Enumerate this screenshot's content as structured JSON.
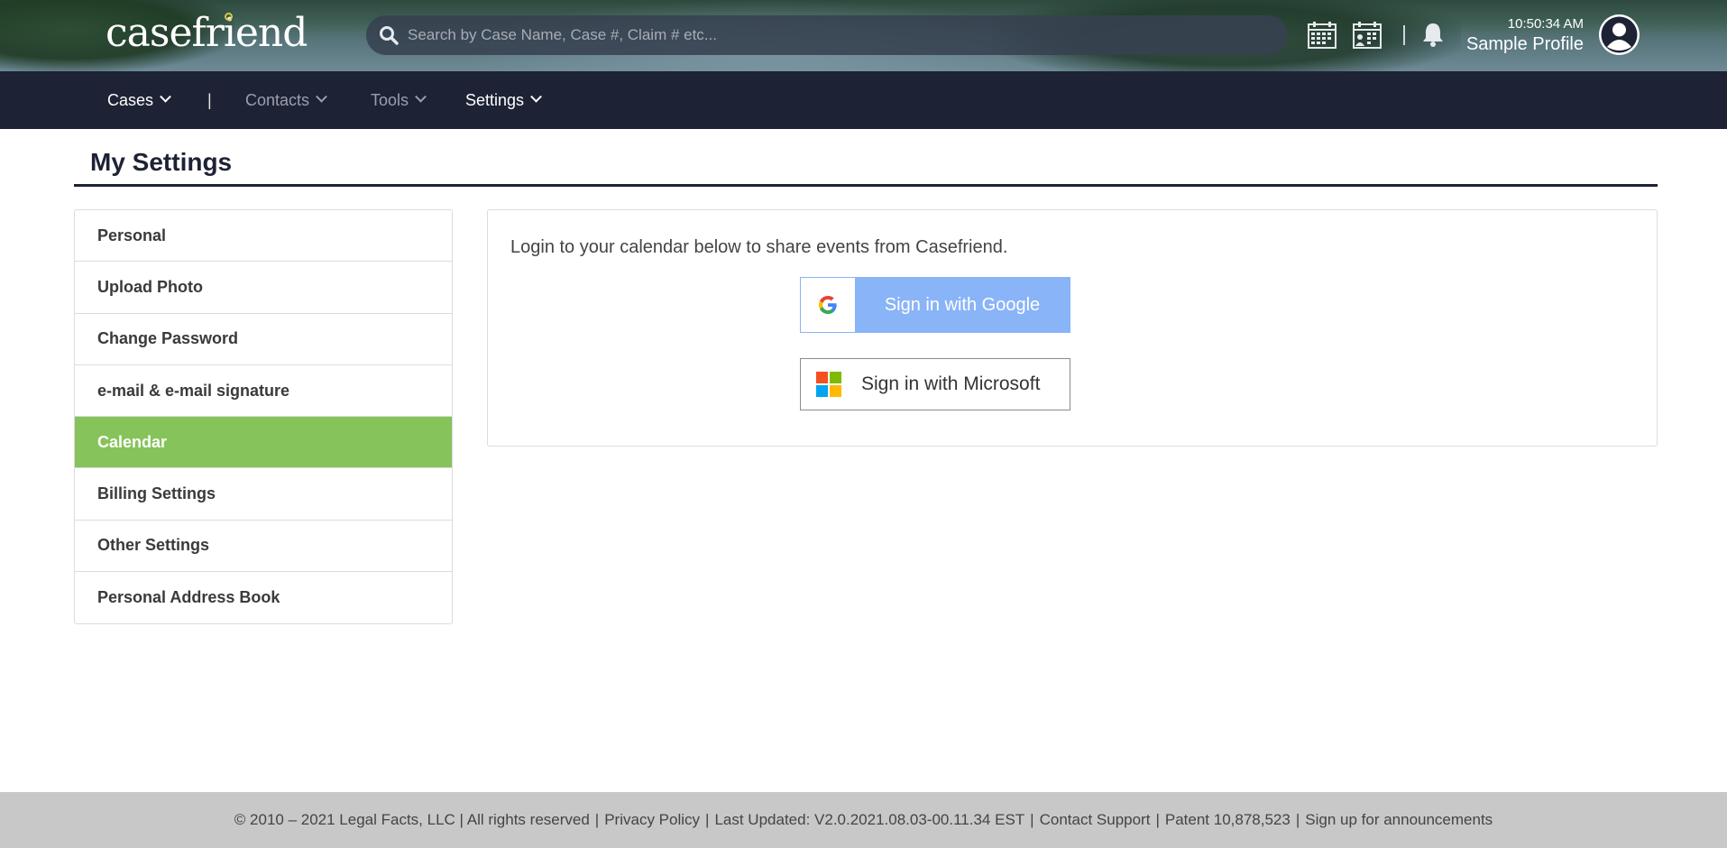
{
  "header": {
    "logo_text": "casefriend",
    "search_placeholder": "Search by Case Name, Case #, Claim # etc...",
    "clock": "10:50:34 AM",
    "profile_name": "Sample Profile"
  },
  "nav": {
    "items": [
      {
        "label": "Cases",
        "color": "#ffffff"
      },
      {
        "label": "Contacts",
        "color": "#9aa0ad"
      },
      {
        "label": "Tools",
        "color": "#9aa0ad"
      },
      {
        "label": "Settings",
        "color": "#ffffff"
      }
    ],
    "separator": "|"
  },
  "page": {
    "title": "My Settings"
  },
  "sidebar": {
    "items": [
      {
        "label": "Personal"
      },
      {
        "label": "Upload Photo"
      },
      {
        "label": "Change Password"
      },
      {
        "label": "e-mail & e-mail signature"
      },
      {
        "label": "Calendar",
        "active": true
      },
      {
        "label": "Billing Settings"
      },
      {
        "label": "Other Settings"
      },
      {
        "label": "Personal Address Book"
      }
    ]
  },
  "calendar": {
    "instructions": "Login to your calendar below to share events from Casefriend.",
    "google_label": "Sign in with Google",
    "microsoft_label": "Sign in with Microsoft"
  },
  "footer": {
    "copyright": "© 2010 – 2021 Legal Facts, LLC | All rights reserved",
    "privacy": "Privacy Policy",
    "last_updated": "Last Updated: V2.0.2021.08.03-00.11.34 EST",
    "contact": "Contact Support",
    "patent": "Patent 10,878,523",
    "signup": "Sign up for announcements",
    "separator": "|"
  },
  "colors": {
    "navbar": "#1e2235",
    "active_item": "#86c35a",
    "google_button": "#8ab4f8",
    "footer": "#c8c8c8"
  }
}
